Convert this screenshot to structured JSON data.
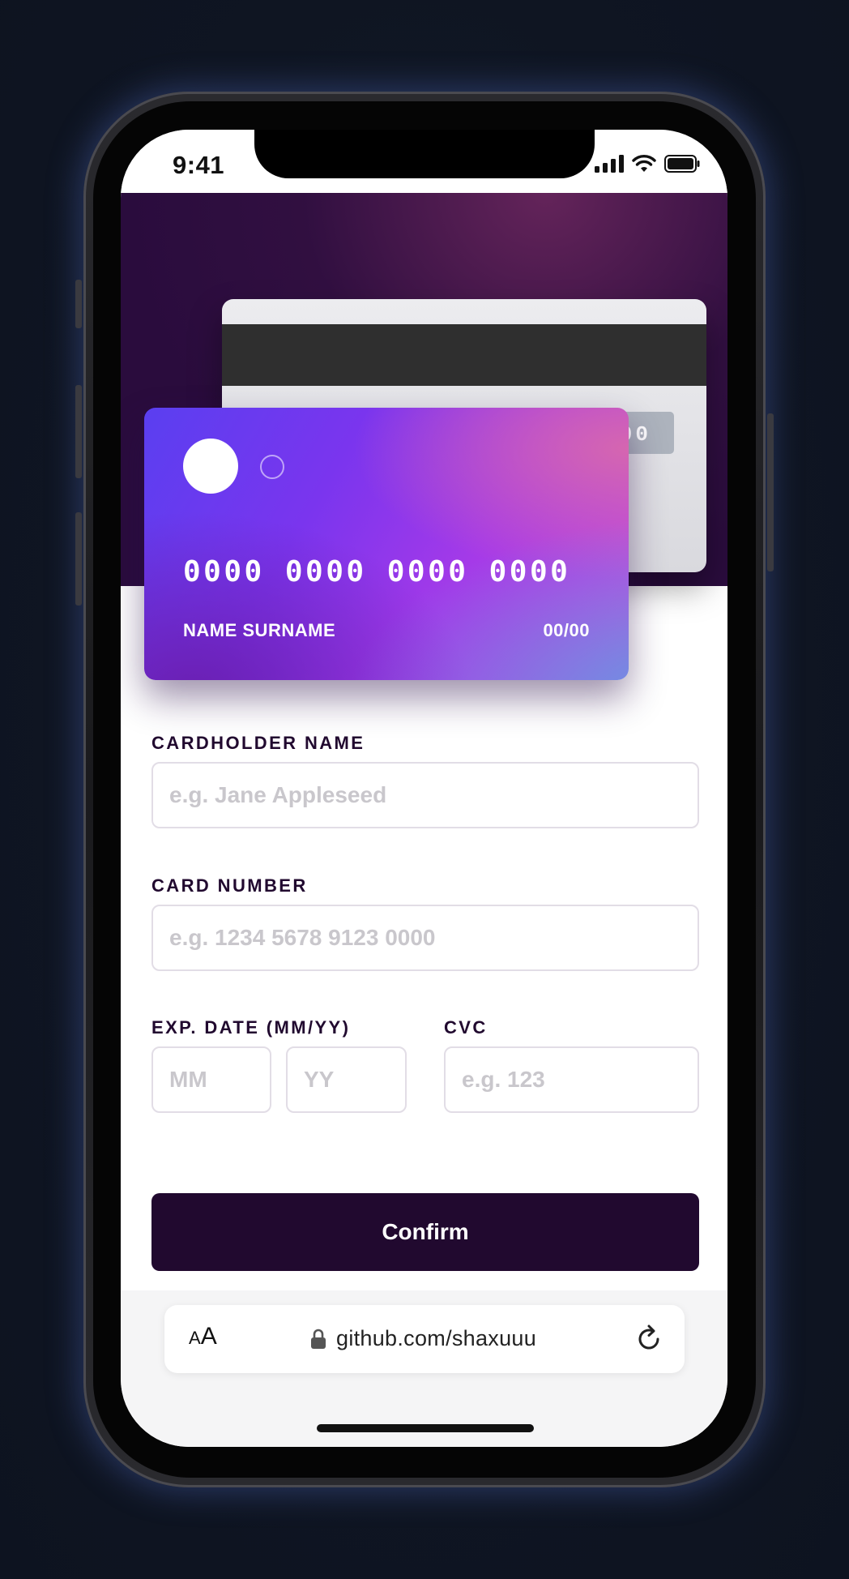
{
  "status_bar": {
    "time": "9:41"
  },
  "card_back": {
    "cvc": "000"
  },
  "card_front": {
    "number": "0000 0000 0000 0000",
    "name": "NAME SURNAME",
    "expiry": "00/00"
  },
  "form": {
    "cardholder_label": "CARDHOLDER NAME",
    "cardholder_placeholder": "e.g. Jane Appleseed",
    "number_label": "CARD NUMBER",
    "number_placeholder": "e.g. 1234 5678 9123 0000",
    "expiry_label": "EXP. DATE (MM/YY)",
    "month_placeholder": "MM",
    "year_placeholder": "YY",
    "cvc_label": "CVC",
    "cvc_placeholder": "e.g. 123",
    "confirm_label": "Confirm"
  },
  "browser": {
    "aa_small": "A",
    "aa_large": "A",
    "url": "github.com/shaxuuu"
  },
  "colors": {
    "accent_dark": "#21092f",
    "input_border": "#e2dde6",
    "card_gradient_start": "#5a3ff0",
    "card_gradient_end": "#c44bdb"
  },
  "icons": {
    "status": [
      "signal-icon",
      "wifi-icon",
      "battery-icon"
    ],
    "browser": [
      "lock-icon",
      "reload-icon"
    ]
  }
}
